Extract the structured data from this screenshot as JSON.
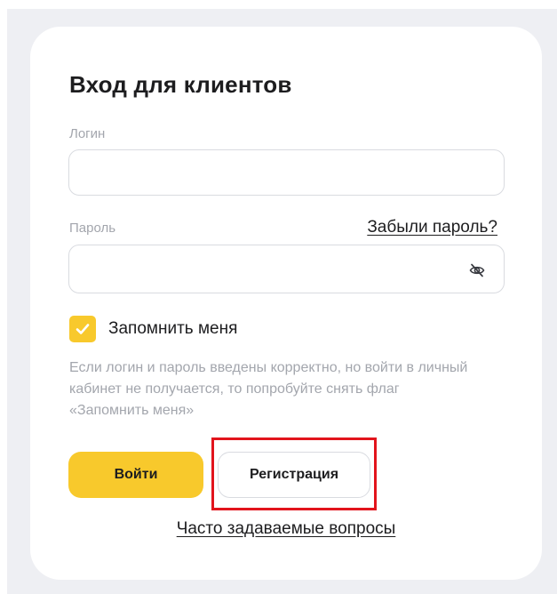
{
  "form": {
    "title": "Вход для клиентов",
    "login_label": "Логин",
    "login_value": "",
    "login_placeholder": "",
    "password_label": "Пароль",
    "password_value": "",
    "password_placeholder": "",
    "forgot_link": "Забыли пароль?",
    "remember_label": "Запомнить меня",
    "remember_checked": true,
    "hint": "Если логин и пароль введены корректно, но войти в личный кабинет не получается, то попробуйте снять флаг «Запомнить меня»",
    "login_button": "Войти",
    "register_button": "Регистрация",
    "faq_link": "Часто задаваемые вопросы"
  },
  "icons": {
    "password_toggle": "eye-off-icon",
    "checkbox_mark": "checkmark-icon"
  },
  "colors": {
    "accent": "#f8c92c",
    "highlight": "#e2141c",
    "background": "#eeeff3",
    "muted_text": "#a3a6ad",
    "text": "#1d1d1f"
  }
}
